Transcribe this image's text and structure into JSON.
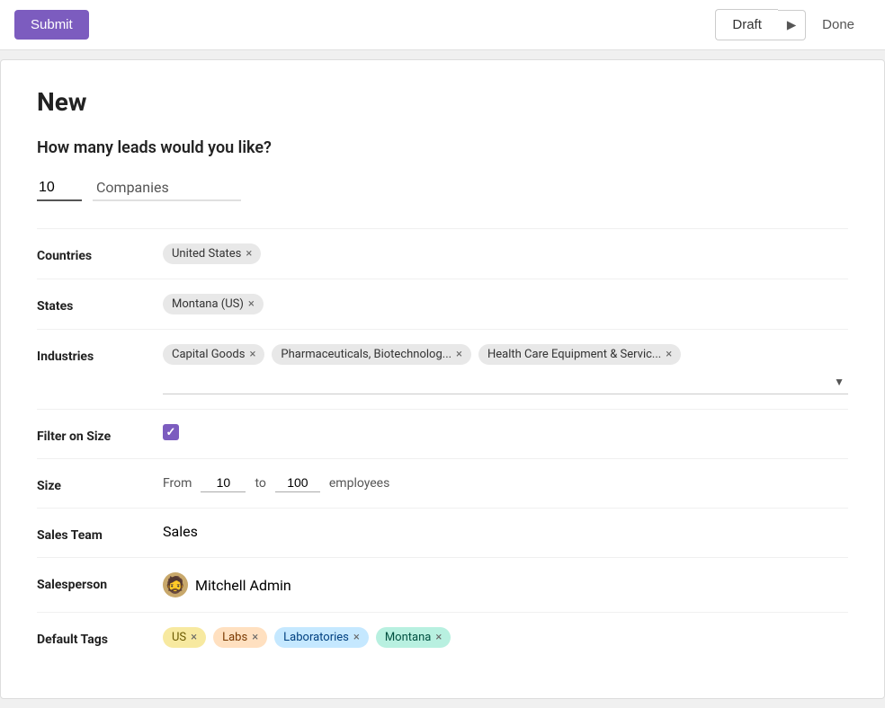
{
  "topbar": {
    "submit_label": "Submit",
    "draft_label": "Draft",
    "done_label": "Done"
  },
  "page": {
    "title": "New",
    "question": "How many leads would you like?"
  },
  "leads": {
    "count": "10",
    "type": "Companies"
  },
  "form": {
    "countries_label": "Countries",
    "countries": [
      {
        "label": "United States",
        "id": "united-states"
      }
    ],
    "states_label": "States",
    "states": [
      {
        "label": "Montana (US)",
        "id": "montana-us"
      }
    ],
    "industries_label": "Industries",
    "industries": [
      {
        "label": "Capital Goods",
        "id": "capital-goods"
      },
      {
        "label": "Pharmaceuticals, Biotechnolog...",
        "id": "pharma"
      },
      {
        "label": "Health Care Equipment & Servic...",
        "id": "health-care"
      }
    ],
    "filter_on_size_label": "Filter on Size",
    "size_label": "Size",
    "size_from_label": "From",
    "size_from_value": "10",
    "size_to_label": "to",
    "size_to_value": "100",
    "size_employees_label": "employees",
    "sales_team_label": "Sales Team",
    "sales_team_value": "Sales",
    "salesperson_label": "Salesperson",
    "salesperson_name": "Mitchell Admin",
    "salesperson_avatar_emoji": "🧔",
    "default_tags_label": "Default Tags",
    "default_tags": [
      {
        "label": "US",
        "id": "tag-us",
        "color": "us"
      },
      {
        "label": "Labs",
        "id": "tag-labs",
        "color": "labs"
      },
      {
        "label": "Laboratories",
        "id": "tag-laboratories",
        "color": "laboratories"
      },
      {
        "label": "Montana",
        "id": "tag-montana",
        "color": "montana"
      }
    ]
  }
}
